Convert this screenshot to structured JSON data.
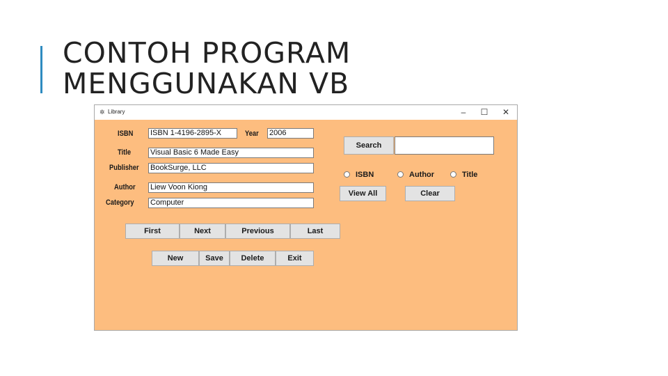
{
  "slide": {
    "title_line1": "CONTOH PROGRAM",
    "title_line2": "MENGGUNAKAN VB"
  },
  "window": {
    "title": "Library",
    "minimize": "–",
    "maximize": "☐",
    "close": "✕"
  },
  "form": {
    "isbn_label": "ISBN",
    "isbn_value": "ISBN 1-4196-2895-X",
    "year_label": "Year",
    "year_value": "2006",
    "title_label": "Title",
    "title_value": "Visual Basic 6 Made Easy",
    "publisher_label": "Publisher",
    "publisher_value": "BookSurge, LLC",
    "author_label": "Author",
    "author_value": "Liew Voon Kiong",
    "category_label": "Category",
    "category_value": "Computer"
  },
  "search": {
    "button": "Search",
    "value": "",
    "radio_isbn": "ISBN",
    "radio_author": "Author",
    "radio_title": "Title",
    "view_all": "View All",
    "clear": "Clear"
  },
  "nav": {
    "first": "First",
    "next": "Next",
    "previous": "Previous",
    "last": "Last"
  },
  "actions": {
    "new": "New",
    "save": "Save",
    "delete": "Delete",
    "exit": "Exit"
  },
  "colors": {
    "form_bg": "#fdbd7f",
    "accent": "#2e8bc0"
  }
}
